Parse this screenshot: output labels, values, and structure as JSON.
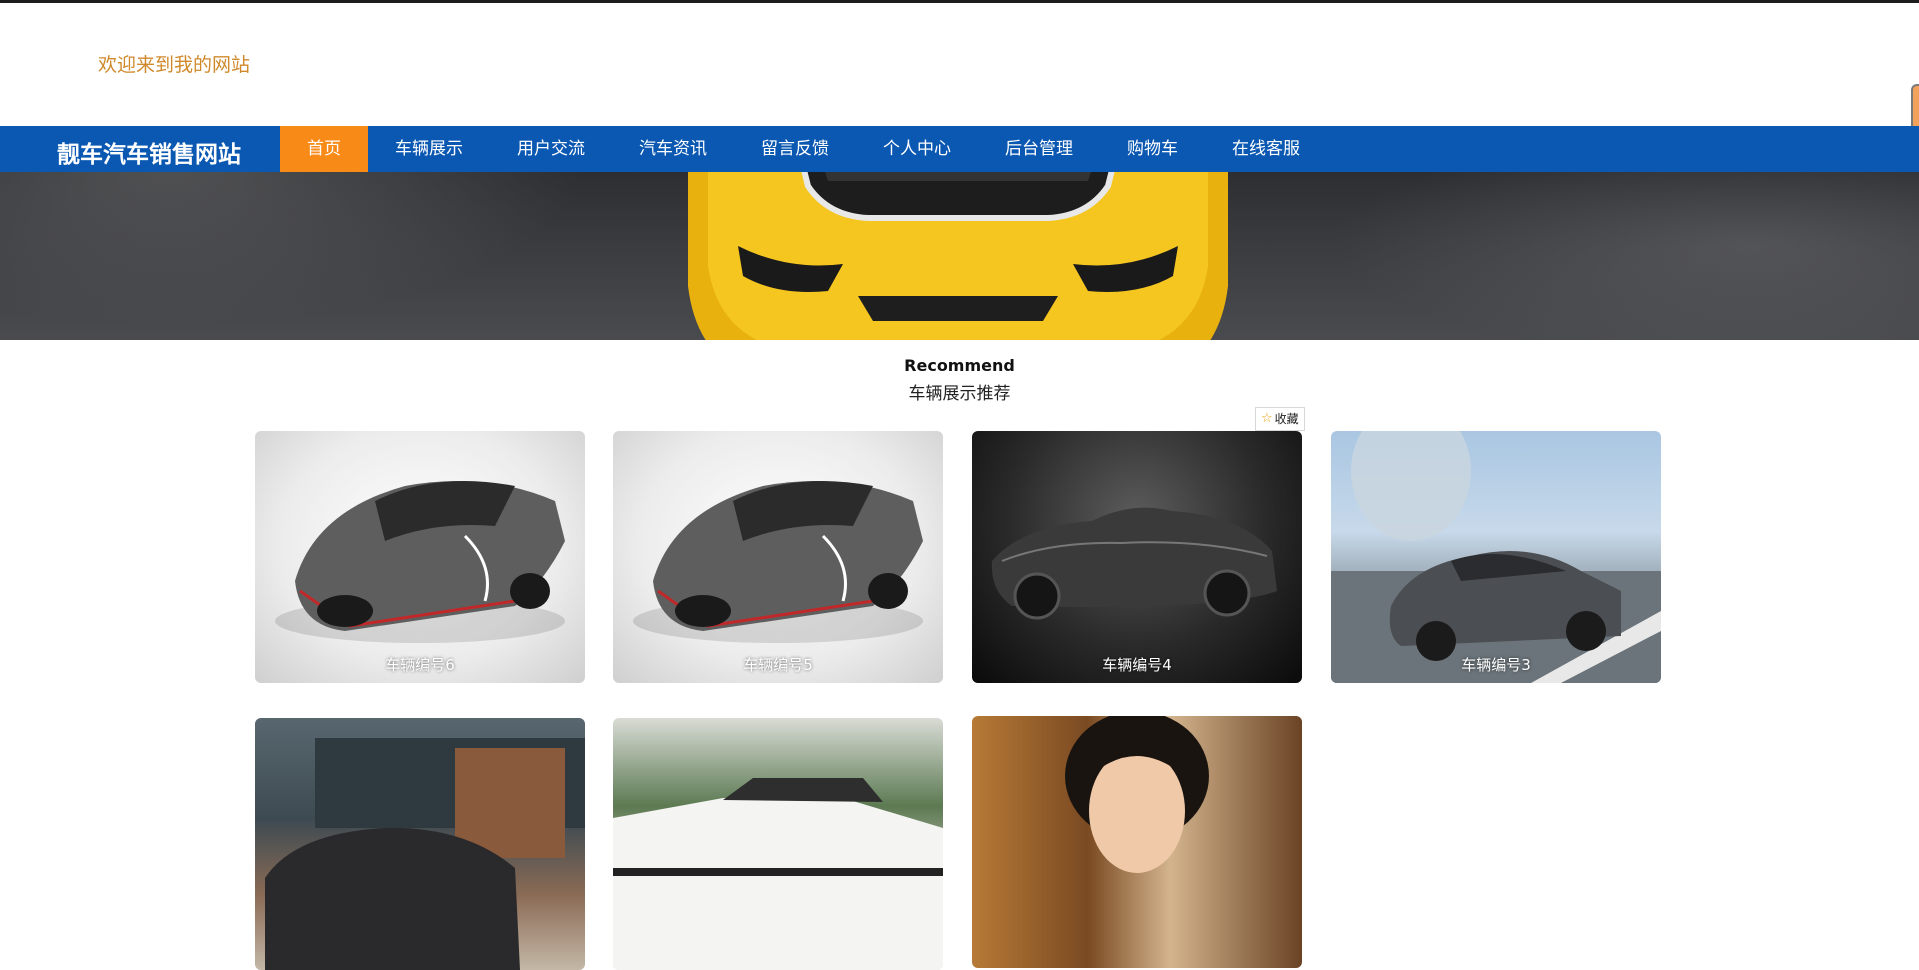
{
  "header": {
    "welcome_text": "欢迎来到我的网站"
  },
  "nav": {
    "logo": "靓车汽车销售网站",
    "items": [
      {
        "label": "首页",
        "active": true
      },
      {
        "label": "车辆展示",
        "active": false
      },
      {
        "label": "用户交流",
        "active": false
      },
      {
        "label": "汽车资讯",
        "active": false
      },
      {
        "label": "留言反馈",
        "active": false
      },
      {
        "label": "个人中心",
        "active": false
      },
      {
        "label": "后台管理",
        "active": false
      },
      {
        "label": "购物车",
        "active": false
      },
      {
        "label": "在线客服",
        "active": false
      }
    ],
    "bar_color": "#0b58b2",
    "active_color": "#f88a18"
  },
  "carousel": {
    "slide_count": 3,
    "active_index": 2
  },
  "recommend": {
    "title_en": "Recommend",
    "title_cn": "车辆展示推荐",
    "favorite_label": "收藏",
    "favorite_icon": "star-icon",
    "cards": [
      {
        "caption": "车辆编号6",
        "image": "silver-supercar"
      },
      {
        "caption": "车辆编号5",
        "image": "silver-supercar"
      },
      {
        "caption": "车辆编号4",
        "image": "dark-concept-roadster"
      },
      {
        "caption": "车辆编号3",
        "image": "grey-sedan-on-road"
      },
      {
        "caption": "",
        "image": "sedan-in-front-of-building"
      },
      {
        "caption": "",
        "image": "white-coupe-on-track"
      },
      {
        "caption": "",
        "image": "woman-portrait"
      }
    ]
  }
}
